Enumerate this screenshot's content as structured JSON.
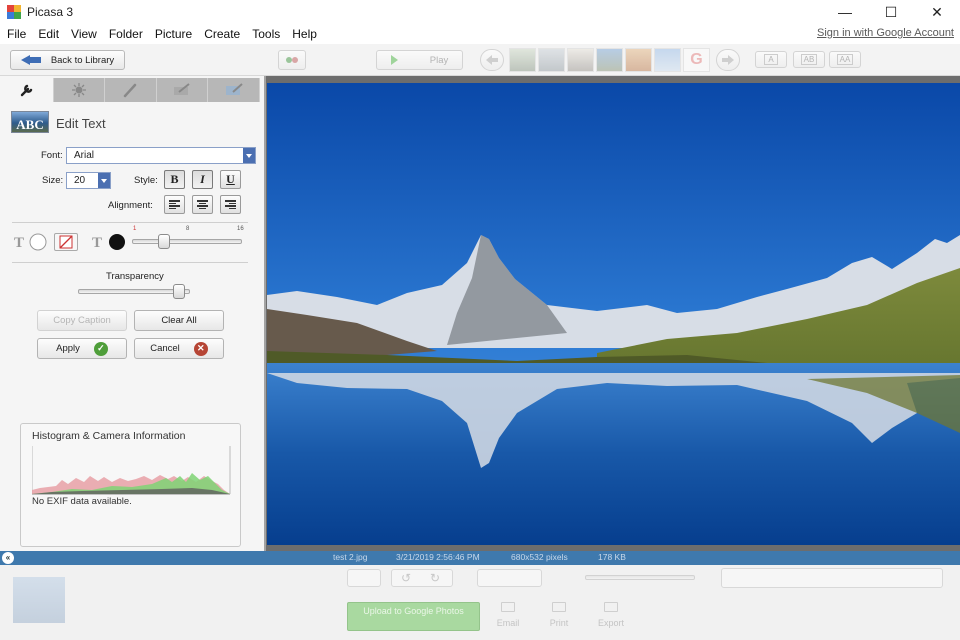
{
  "window": {
    "title": "Picasa 3",
    "minimize": "—",
    "maximize": "☐",
    "close": "✕"
  },
  "menu": [
    "File",
    "Edit",
    "View",
    "Folder",
    "Picture",
    "Create",
    "Tools",
    "Help"
  ],
  "signin_link": "Sign in with Google Account",
  "toolbar": {
    "back_label": "Back to Library",
    "play_label": "Play",
    "text_size_labels": [
      "A",
      "AB",
      "AA"
    ]
  },
  "edit_panel": {
    "icon_text": "ABC",
    "title": "Edit Text",
    "font_label": "Font:",
    "font_value": "Arial",
    "size_label": "Size:",
    "size_value": "20",
    "style_label": "Style:",
    "bold": "B",
    "italic": "I",
    "underline": "U",
    "alignment_label": "Alignment:",
    "outline_ticks": [
      "1",
      "8",
      "16"
    ],
    "transparency_label": "Transparency",
    "transparency_level": 0.95,
    "outline_level": 0.27,
    "copy_caption": "Copy Caption",
    "clear_all": "Clear All",
    "apply": "Apply",
    "cancel": "Cancel"
  },
  "histogram": {
    "title": "Histogram & Camera Information",
    "note": "No EXIF data available."
  },
  "status": {
    "collapse_glyph": "«",
    "filename": "test 2.jpg",
    "datetime": "3/21/2019 2:56:46 PM",
    "dimensions": "680x532 pixels",
    "filesize": "178 KB"
  },
  "bottom": {
    "share_label": "Upload to Google Photos",
    "email": "Email",
    "print": "Print",
    "export": "Export"
  },
  "colors": {
    "status_bar": "#3f79ad",
    "apply_badge": "#4f9e3a",
    "cancel_badge": "#b64535",
    "accent_blue": "#4b6fb1"
  }
}
